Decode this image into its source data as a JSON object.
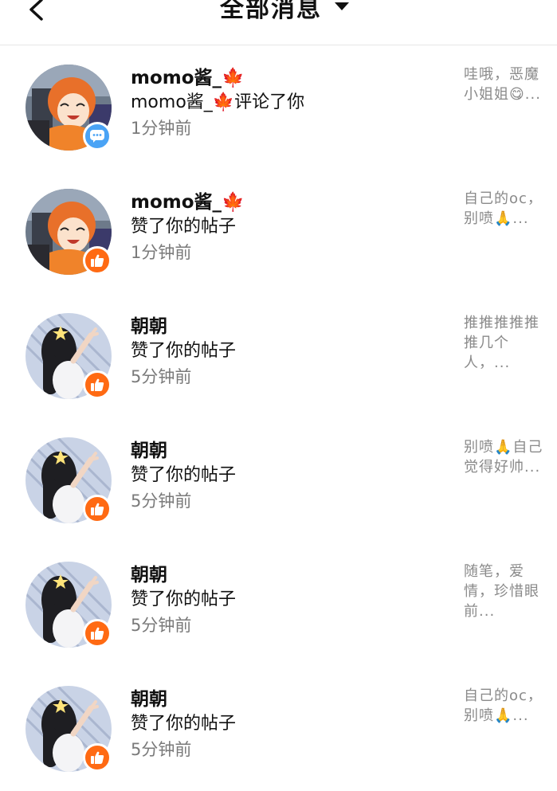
{
  "header": {
    "title": "全部消息"
  },
  "colors": {
    "like_badge": "#ff6a13",
    "comment_badge": "#4aa3f5",
    "secondary_text": "#8a8a8a"
  },
  "messages": [
    {
      "name": "momo酱_🍁",
      "action": "momo酱_🍁评论了你",
      "time": "1分钟前",
      "preview": "哇哦，恶魔小姐姐😋...",
      "badge": "comment-icon",
      "avatar": "orange-hair-avatar"
    },
    {
      "name": "momo酱_🍁",
      "action": "赞了你的帖子",
      "time": "1分钟前",
      "preview": "自己的oc，别喷🙏...",
      "badge": "thumbs-up-icon",
      "avatar": "orange-hair-avatar"
    },
    {
      "name": "朝朝",
      "action": "赞了你的帖子",
      "time": "5分钟前",
      "preview": "推推推推推推几个人，...",
      "badge": "thumbs-up-icon",
      "avatar": "dark-hair-girl-avatar"
    },
    {
      "name": "朝朝",
      "action": "赞了你的帖子",
      "time": "5分钟前",
      "preview": "别喷🙏自己觉得好帅...",
      "badge": "thumbs-up-icon",
      "avatar": "dark-hair-girl-avatar"
    },
    {
      "name": "朝朝",
      "action": "赞了你的帖子",
      "time": "5分钟前",
      "preview": "随笔，爱情，珍惜眼前...",
      "badge": "thumbs-up-icon",
      "avatar": "dark-hair-girl-avatar"
    },
    {
      "name": "朝朝",
      "action": "赞了你的帖子",
      "time": "5分钟前",
      "preview": "自己的oc，别喷🙏...",
      "badge": "thumbs-up-icon",
      "avatar": "dark-hair-girl-avatar"
    }
  ]
}
